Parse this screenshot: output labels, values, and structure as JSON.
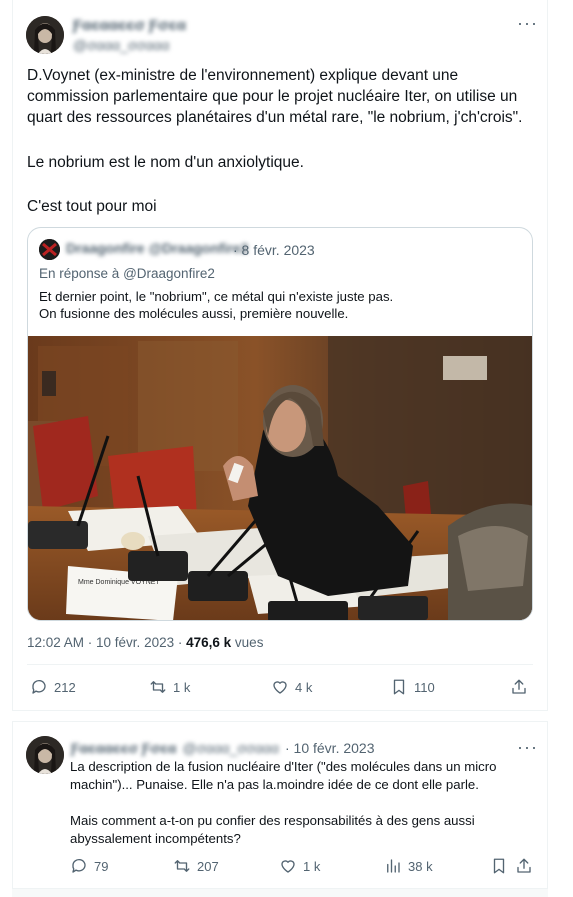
{
  "tweet1": {
    "author_name": "Ƒαєααєєσ Ƒσєα",
    "author_handle": "@σααα_σσααα",
    "more_icon": "more-icon",
    "text_paragraphs": [
      "D.Voynet (ex-ministre de l'environnement) explique devant une commission parlementaire que pour le projet nucléaire Iter, on utilise un quart des ressources planétaires d'un métal rare, \"le nobrium, j'ch'crois\".",
      "Le nobrium est le nom d'un anxiolytique.",
      "C'est tout pour moi"
    ],
    "quote": {
      "author_name": "Draagonfire @Draagonfire2",
      "date": "· 8 févr. 2023",
      "reply_prefix": "En réponse à",
      "reply_handle": "@Draagonfire2",
      "text_lines": [
        "Et dernier point, le \"nobrium\", ce métal qui n'existe juste pas.",
        "On fusionne des molécules aussi, première nouvelle."
      ],
      "nameplate": "Mme Dominique VOYNET"
    },
    "time": "12:02 AM · 10 févr. 2023 ·",
    "views_count": "476,6 k",
    "views_label": "vues",
    "actions": {
      "replies": "212",
      "retweets": "1 k",
      "likes": "4 k",
      "bookmarks": "110"
    }
  },
  "tweet2": {
    "author_name": "Ƒαєααєєσ Ƒσєα",
    "author_handle": "@σααα_σσααα",
    "date": "· 10 févr. 2023",
    "text_paragraphs": [
      "La description de la fusion nucléaire d'Iter (\"des molécules dans un micro machin\")...  Punaise. Elle n'a pas la.moindre idée de ce dont elle parle.",
      "Mais comment a-t-on pu confier des responsabilités à des gens aussi abyssalement incompétents?"
    ],
    "actions": {
      "replies": "79",
      "retweets": "207",
      "likes": "1 k",
      "views": "38 k"
    }
  }
}
